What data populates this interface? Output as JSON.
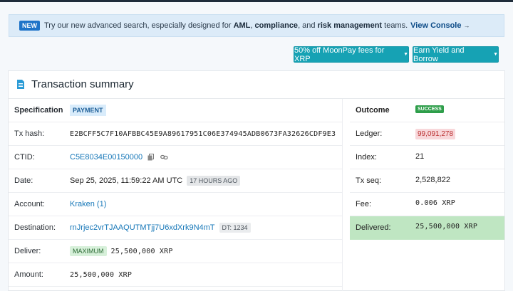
{
  "banner": {
    "badge": "NEW",
    "text_before": "Try our new advanced search, especially designed for",
    "aml": "AML",
    "comma": ",",
    "compliance": "compliance",
    "and": ", and",
    "risk": "risk management",
    "teams": "teams.",
    "link": "View Console",
    "arrow": "→"
  },
  "buttons": {
    "moonpay": "50% off MoonPay fees for XRP",
    "yield": "Earn Yield and Borrow"
  },
  "card": {
    "title": "Transaction summary"
  },
  "left": {
    "specification": {
      "label": "Specification",
      "tag": "PAYMENT"
    },
    "tx_hash": {
      "label": "Tx hash:",
      "value": "E2BCFF5C7F10AFBBC45E9A89617951C06E374945ADB0673FA32626CDF9E3B"
    },
    "ctid": {
      "label": "CTID:",
      "value": "C5E8034E00150000"
    },
    "date": {
      "label": "Date:",
      "value": "Sep 25, 2025, 11:59:22 AM UTC",
      "ago": "17 HOURS AGO"
    },
    "account": {
      "label": "Account:",
      "value": "Kraken (1)"
    },
    "destination": {
      "label": "Destination:",
      "value": "rnJrjec2vrTJAAQUTMTjj7U6xdXrk9N4mT",
      "dt": "DT: 1234"
    },
    "deliver": {
      "label": "Deliver:",
      "tag": "MAXIMUM",
      "value": "25,500,000 XRP"
    },
    "amount": {
      "label": "Amount:",
      "value": "25,500,000 XRP"
    }
  },
  "right": {
    "outcome": {
      "label": "Outcome",
      "tag": "SUCCESS"
    },
    "ledger": {
      "label": "Ledger:",
      "value": "99,091,278"
    },
    "index": {
      "label": "Index:",
      "value": "21"
    },
    "tx_seq": {
      "label": "Tx seq:",
      "value": "2,528,822"
    },
    "fee": {
      "label": "Fee:",
      "value": "0.006 XRP"
    },
    "delivered": {
      "label": "Delivered:",
      "value": "25,500,000 XRP"
    }
  },
  "colors": {
    "accent": "#16a2b4",
    "success": "#2e9e4a",
    "delivered_bg": "#bfe6c2"
  }
}
